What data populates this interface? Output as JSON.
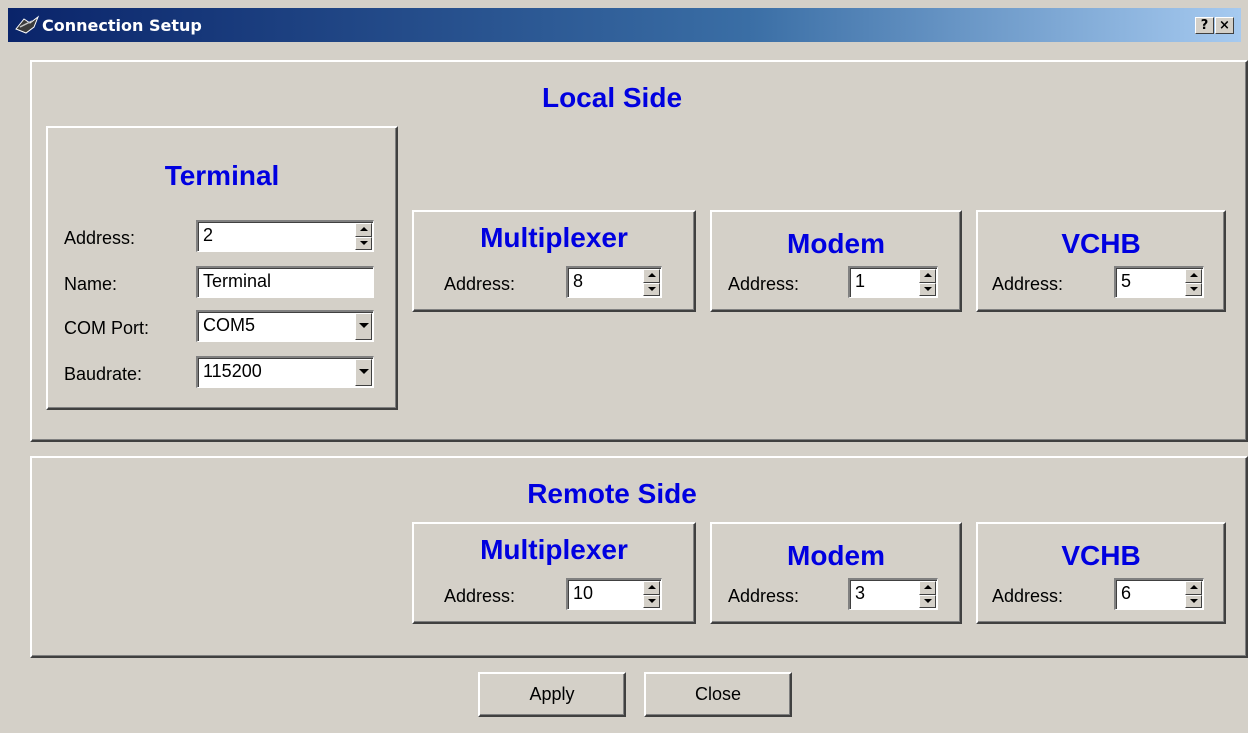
{
  "window": {
    "title": "Connection Setup",
    "help_label": "?",
    "close_label": "×"
  },
  "local": {
    "title": "Local Side",
    "terminal": {
      "title": "Terminal",
      "address_label": "Address:",
      "address_value": "2",
      "name_label": "Name:",
      "name_value": "Terminal",
      "com_label": "COM Port:",
      "com_value": "COM5",
      "baud_label": "Baudrate:",
      "baud_value": "115200"
    },
    "multiplexer": {
      "title": "Multiplexer",
      "address_label": "Address:",
      "address_value": "8"
    },
    "modem": {
      "title": "Modem",
      "address_label": "Address:",
      "address_value": "1"
    },
    "vchb": {
      "title": "VCHB",
      "address_label": "Address:",
      "address_value": "5"
    }
  },
  "remote": {
    "title": "Remote Side",
    "multiplexer": {
      "title": "Multiplexer",
      "address_label": "Address:",
      "address_value": "10"
    },
    "modem": {
      "title": "Modem",
      "address_label": "Address:",
      "address_value": "3"
    },
    "vchb": {
      "title": "VCHB",
      "address_label": "Address:",
      "address_value": "6"
    }
  },
  "buttons": {
    "apply": "Apply",
    "close": "Close"
  }
}
